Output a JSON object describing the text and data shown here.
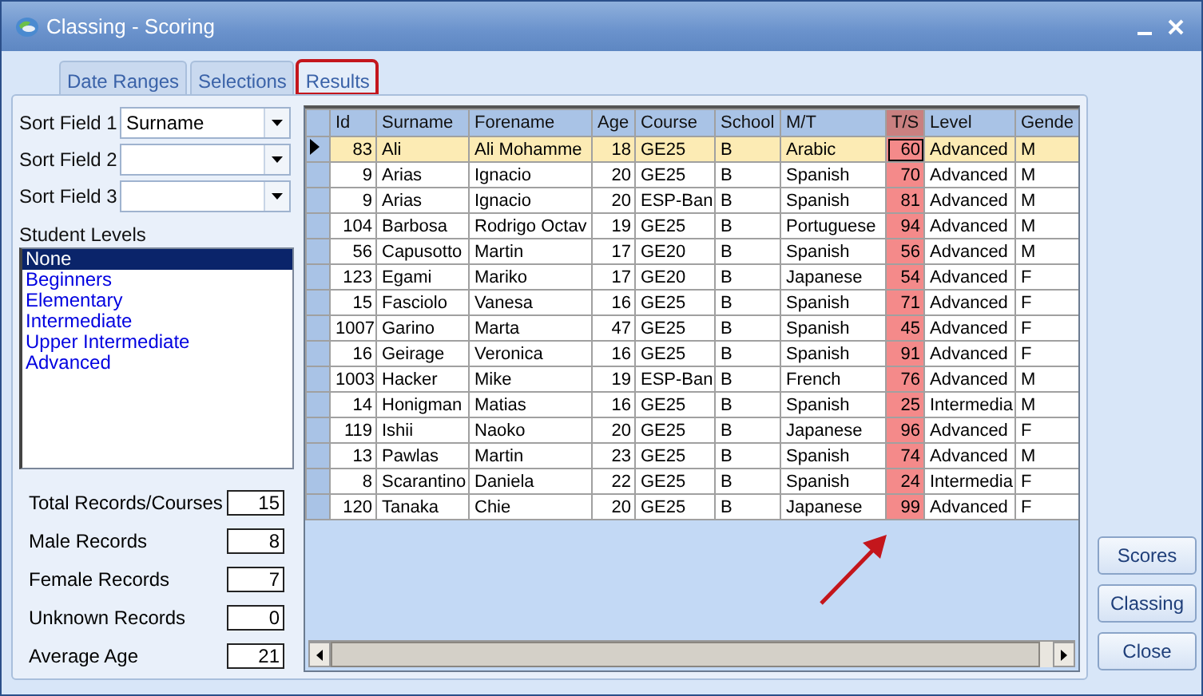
{
  "window": {
    "title": "Classing - Scoring"
  },
  "tabs": [
    {
      "label": "Date Ranges",
      "selected": false,
      "highlighted": false
    },
    {
      "label": "Selections",
      "selected": false,
      "highlighted": false
    },
    {
      "label": "Results",
      "selected": true,
      "highlighted": true
    }
  ],
  "sort_fields": [
    {
      "label": "Sort Field 1",
      "value": "Surname"
    },
    {
      "label": "Sort Field 2"
    },
    {
      "label": "Sort Field 3"
    }
  ],
  "student_levels": {
    "label": "Student Levels",
    "items": [
      {
        "label": "None",
        "selected": true
      },
      {
        "label": "Beginners",
        "selected": false
      },
      {
        "label": "Elementary",
        "selected": false
      },
      {
        "label": "Intermediate",
        "selected": false
      },
      {
        "label": "Upper Intermediate",
        "selected": false
      },
      {
        "label": "Advanced",
        "selected": false
      }
    ]
  },
  "stats": [
    {
      "label": "Total Records/Courses",
      "value": "15"
    },
    {
      "label": "Male Records",
      "value": "8"
    },
    {
      "label": "Female Records",
      "value": "7"
    },
    {
      "label": "Unknown Records",
      "value": "0"
    },
    {
      "label": "Average Age",
      "value": "21"
    }
  ],
  "table": {
    "columns": [
      {
        "label": "Id",
        "highlighted": false
      },
      {
        "label": "Surname",
        "highlighted": false
      },
      {
        "label": "Forename",
        "highlighted": false
      },
      {
        "label": "Age",
        "highlighted": false
      },
      {
        "label": "Course",
        "highlighted": false
      },
      {
        "label": "School",
        "highlighted": false
      },
      {
        "label": "M/T",
        "highlighted": false
      },
      {
        "label": "T/S",
        "highlighted": true
      },
      {
        "label": "Level",
        "highlighted": false
      },
      {
        "label": "Gende",
        "highlighted": false
      }
    ],
    "rows": [
      {
        "selected": true,
        "cells": [
          "83",
          "Ali",
          "Ali Mohamme",
          "18",
          "GE25",
          "B",
          "Arabic",
          "60",
          "Advanced",
          "M"
        ]
      },
      {
        "selected": false,
        "cells": [
          "9",
          "Arias",
          "Ignacio",
          "20",
          "GE25",
          "B",
          "Spanish",
          "70",
          "Advanced",
          "M"
        ]
      },
      {
        "selected": false,
        "cells": [
          "9",
          "Arias",
          "Ignacio",
          "20",
          "ESP-Ban",
          "B",
          "Spanish",
          "81",
          "Advanced",
          "M"
        ]
      },
      {
        "selected": false,
        "cells": [
          "104",
          "Barbosa",
          "Rodrigo Octav",
          "19",
          "GE25",
          "B",
          "Portuguese",
          "94",
          "Advanced",
          "M"
        ]
      },
      {
        "selected": false,
        "cells": [
          "56",
          "Capusotto",
          "Martin",
          "17",
          "GE20",
          "B",
          "Spanish",
          "56",
          "Advanced",
          "M"
        ]
      },
      {
        "selected": false,
        "cells": [
          "123",
          "Egami",
          "Mariko",
          "17",
          "GE20",
          "B",
          "Japanese",
          "54",
          "Advanced",
          "F"
        ]
      },
      {
        "selected": false,
        "cells": [
          "15",
          "Fasciolo",
          "Vanesa",
          "16",
          "GE25",
          "B",
          "Spanish",
          "71",
          "Advanced",
          "F"
        ]
      },
      {
        "selected": false,
        "cells": [
          "1007",
          "Garino",
          "Marta",
          "47",
          "GE25",
          "B",
          "Spanish",
          "45",
          "Advanced",
          "F"
        ]
      },
      {
        "selected": false,
        "cells": [
          "16",
          "Geirage",
          "Veronica",
          "16",
          "GE25",
          "B",
          "Spanish",
          "91",
          "Advanced",
          "F"
        ]
      },
      {
        "selected": false,
        "cells": [
          "1003",
          "Hacker",
          "Mike",
          "19",
          "ESP-Ban",
          "B",
          "French",
          "76",
          "Advanced",
          "M"
        ]
      },
      {
        "selected": false,
        "cells": [
          "14",
          "Honigman",
          "Matias",
          "16",
          "GE25",
          "B",
          "Spanish",
          "25",
          "Intermedia",
          "M"
        ]
      },
      {
        "selected": false,
        "cells": [
          "119",
          "Ishii",
          "Naoko",
          "20",
          "GE25",
          "B",
          "Japanese",
          "96",
          "Advanced",
          "F"
        ]
      },
      {
        "selected": false,
        "cells": [
          "13",
          "Pawlas",
          "Martin",
          "23",
          "GE25",
          "B",
          "Spanish",
          "74",
          "Advanced",
          "M"
        ]
      },
      {
        "selected": false,
        "cells": [
          "8",
          "Scarantino",
          "Daniela",
          "22",
          "GE25",
          "B",
          "Spanish",
          "24",
          "Intermedia",
          "F"
        ]
      },
      {
        "selected": false,
        "cells": [
          "120",
          "Tanaka",
          "Chie",
          "20",
          "GE25",
          "B",
          "Japanese",
          "99",
          "Advanced",
          "F"
        ]
      }
    ]
  },
  "buttons": [
    "Scores",
    "Classing",
    "Close"
  ]
}
